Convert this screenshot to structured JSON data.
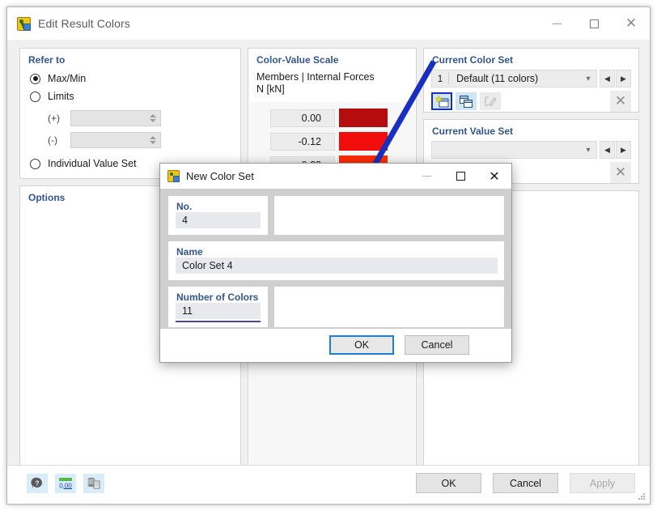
{
  "window": {
    "title": "Edit Result Colors",
    "icon": "app-icon",
    "minimize": "minimize",
    "maximize": "maximize",
    "close": "close"
  },
  "refer_to": {
    "title": "Refer to",
    "options": [
      {
        "label": "Max/Min",
        "selected": true
      },
      {
        "label": "Limits",
        "selected": false
      },
      {
        "label": "Individual Value Set",
        "selected": false
      }
    ],
    "limit_fields": [
      {
        "tag": "(+)",
        "value": ""
      },
      {
        "tag": "(-)",
        "value": ""
      }
    ]
  },
  "options": {
    "title": "Options"
  },
  "scale": {
    "title": "Color-Value Scale",
    "subtitle_line1": "Members | Internal Forces",
    "subtitle_line2": "N [kN]",
    "rows": [
      {
        "value": "0.00",
        "color": "#b50d0d"
      },
      {
        "value": "-0.12",
        "color": "#f20d0d"
      },
      {
        "value": "-0.23",
        "color": "#ff2b00"
      }
    ],
    "slider_color": "#1a86d8",
    "footer_buttons": [
      {
        "name": "scale-linear-icon",
        "selected": false
      },
      {
        "name": "scale-color-icon",
        "selected": true
      }
    ]
  },
  "color_set": {
    "title": "Current Color Set",
    "number": "1",
    "name": "Default (11 colors)",
    "chevron": "⌄",
    "prev": "◀",
    "next": "▶",
    "tools": [
      {
        "name": "new-color-set-icon",
        "selected": true,
        "enabled": true
      },
      {
        "name": "copy-color-set-icon",
        "selected": false,
        "enabled": true
      },
      {
        "name": "edit-color-set-icon",
        "selected": false,
        "enabled": false
      }
    ],
    "delete": "✕"
  },
  "value_set": {
    "title": "Current Value Set",
    "number": "",
    "name": "",
    "chevron": "⌄",
    "prev": "◀",
    "next": "▶",
    "tools": [
      {
        "name": "new-value-set-icon",
        "enabled": false
      },
      {
        "name": "copy-value-set-icon",
        "enabled": false
      },
      {
        "name": "edit-value-set-icon",
        "enabled": false
      }
    ],
    "delete": "✕"
  },
  "bottom_bar": {
    "tools": [
      {
        "name": "help-icon"
      },
      {
        "name": "units-icon"
      },
      {
        "name": "database-copy-icon"
      }
    ],
    "ok": "OK",
    "cancel": "Cancel",
    "apply": "Apply"
  },
  "dialog": {
    "title": "New Color Set",
    "icon": "app-icon",
    "minimize": "minimize",
    "maximize": "maximize",
    "close": "close",
    "fields": [
      {
        "label": "No.",
        "value": "4"
      },
      {
        "label": "Name",
        "value": "Color Set 4"
      },
      {
        "label": "Number of Colors",
        "value": "11"
      }
    ],
    "ok": "OK",
    "cancel": "Cancel"
  },
  "annotation": {
    "arrow_color": "#1730c0"
  }
}
